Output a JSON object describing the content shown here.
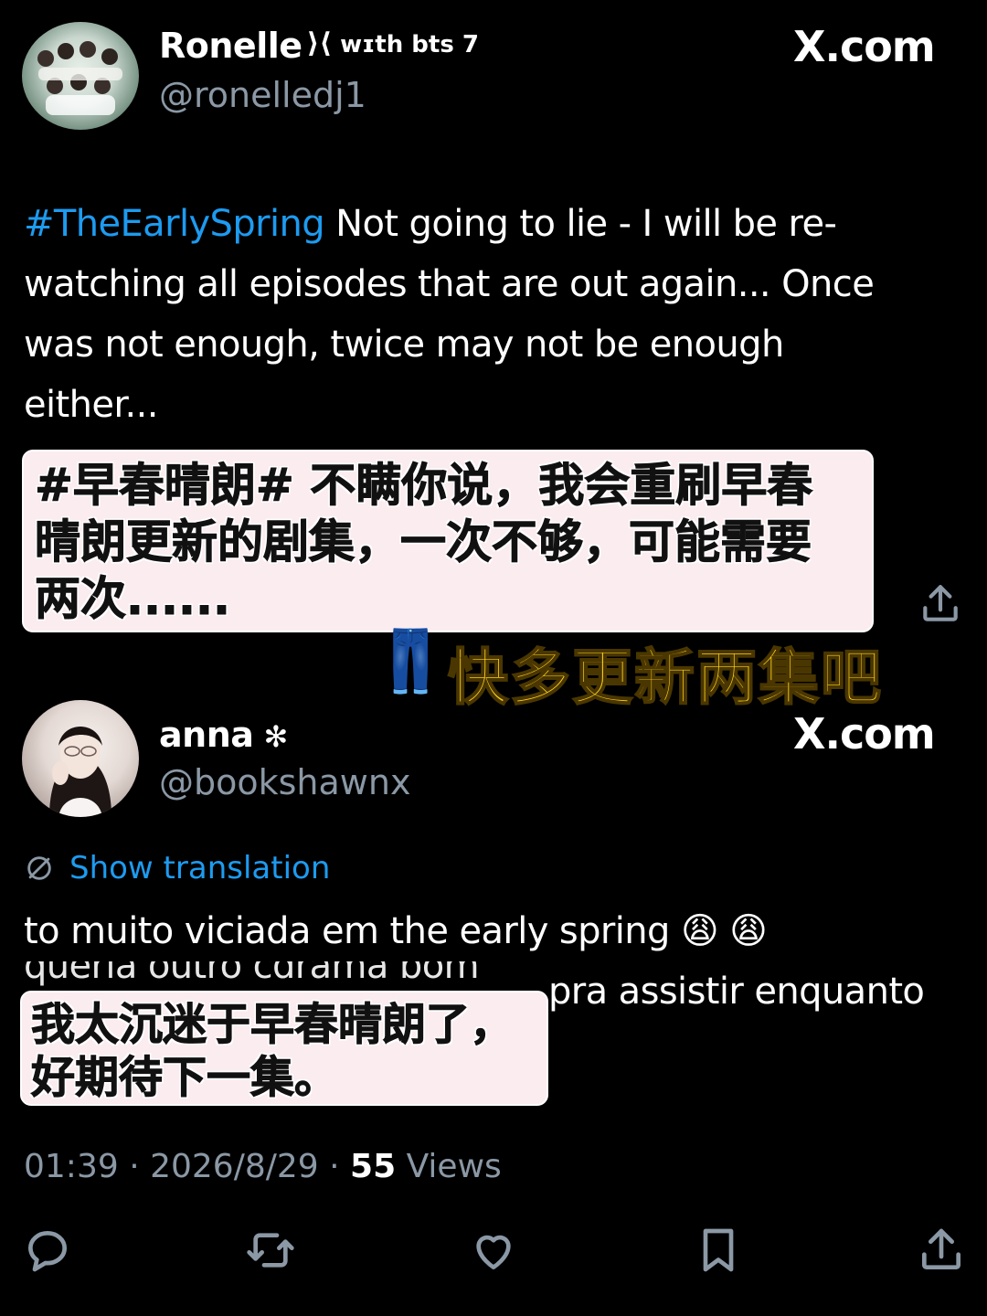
{
  "tweet1": {
    "display_name": "Ronelle",
    "name_suffix": "wɪth bts 7",
    "handle": "@ronelledj1",
    "source": "X.com",
    "hashtag": "#TheEarlySpring",
    "text_line1": "Not going to lie - I will be re-",
    "text_line2": "watching all episodes that are out again... Once",
    "text_line3": "was not enough, twice may not be enough",
    "text_line4": "either...",
    "subtitle_line1": "#早春晴朗# 不瞒你说，我会重刷早春",
    "subtitle_line2": "晴朗更新的剧集，一次不够，可能需要",
    "subtitle_line3": "两次......"
  },
  "caption": {
    "emoji": "👖",
    "text": "快多更新两集吧"
  },
  "tweet2": {
    "display_name": "anna",
    "name_badge": "✻",
    "handle": "@bookshawnx",
    "source": "X.com",
    "show_translation": "Show translation",
    "text_line1": "to muito viciada em the early spring",
    "text_line1_emojis": "😩 😩",
    "text_line2_visible": "pra assistir enquanto",
    "subtitle_line1": "我太沉迷于早春晴朗了，",
    "subtitle_line2": "好期待下一集。",
    "time": "01:39",
    "date": "2026/8/29",
    "views_count": "55",
    "views_label": "Views"
  },
  "icons": {
    "share": "share-icon",
    "reply": "reply-icon",
    "retweet": "retweet-icon",
    "like": "like-icon",
    "bookmark": "bookmark-icon",
    "translate": "translate-icon"
  },
  "colors": {
    "background": "#000000",
    "link_blue": "#1d9bf0",
    "secondary_gray": "#8b98a5",
    "caption_yellow": "#ffd21a",
    "subtitle_box": "#fbecef"
  }
}
